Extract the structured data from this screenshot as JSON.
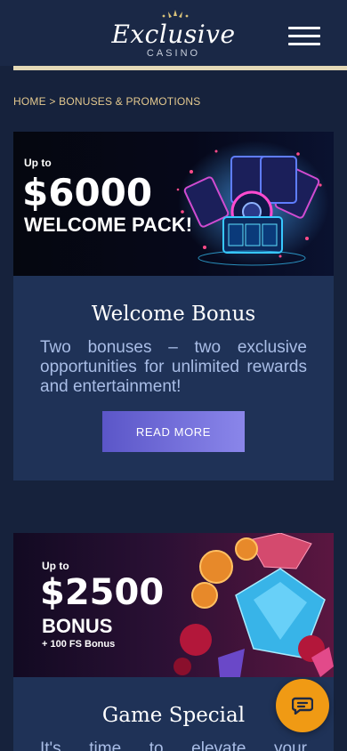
{
  "header": {
    "logo_main": "Exclusive",
    "logo_sub": "CASINO",
    "menu_icon": "hamburger-menu-icon"
  },
  "breadcrumb": {
    "home": "HOME",
    "separator": ">",
    "current": "BONUSES & PROMOTIONS"
  },
  "promos": [
    {
      "banner": {
        "up_to": "Up to",
        "amount": "$6000",
        "subline": "WELCOME PACK!"
      },
      "title": "Welcome Bonus",
      "text": "Two bonuses – two exclusive opportunities for unlimited rewards and entertainment!",
      "button": "READ MORE"
    },
    {
      "banner": {
        "up_to": "Up to",
        "amount": "$2500",
        "subline": "BONUS",
        "extra": "+ 100 FS Bonus"
      },
      "title": "Game Special",
      "text": "It's time to elevate your"
    }
  ],
  "chat": {
    "icon": "chat-icon"
  },
  "colors": {
    "background": "#16223c",
    "card": "#1f3257",
    "accent_gold": "#e4c98f",
    "button": "#6d69d8",
    "chat": "#f09a14"
  }
}
